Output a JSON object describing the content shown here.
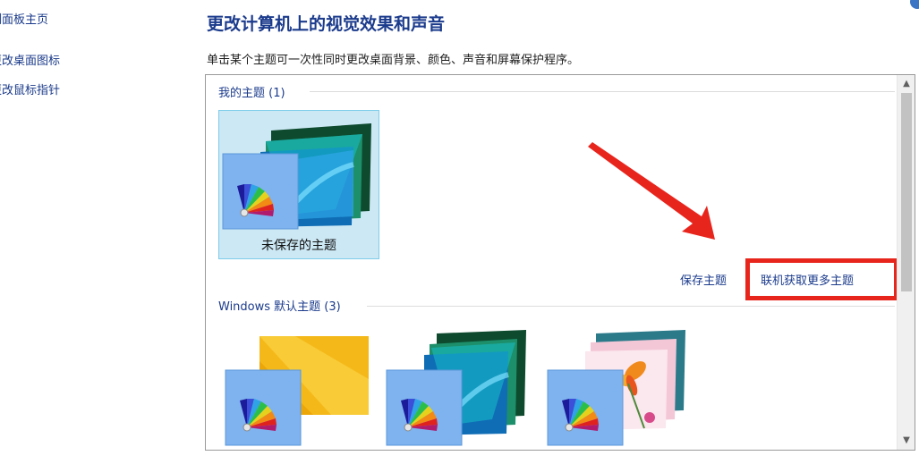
{
  "sidebar": {
    "items": [
      {
        "label": "控制面板主页"
      },
      {
        "label": "更改桌面图标"
      },
      {
        "label": "更改鼠标指针"
      }
    ]
  },
  "header": {
    "title": "更改计算机上的视觉效果和声音",
    "description": "单击某个主题可一次性同时更改桌面背景、颜色、声音和屏幕保护程序。"
  },
  "themes": {
    "my_group": {
      "label": "我的主题 (1)"
    },
    "unsaved_theme": {
      "label": "未保存的主题"
    },
    "save_link": "保存主题",
    "get_more_link": "联机获取更多主题",
    "default_group": {
      "label": "Windows 默认主题 (3)"
    },
    "default_tiles": [
      {
        "name": "windows-theme"
      },
      {
        "name": "lines-and-colors-theme"
      },
      {
        "name": "flowers-theme"
      }
    ]
  },
  "scrollbar": {
    "up_glyph": "▲",
    "down_glyph": "▼"
  },
  "colors": {
    "link_blue": "#1b3b8c",
    "selection_fill": "#cce8f4",
    "annotation_red": "#e8251d"
  }
}
